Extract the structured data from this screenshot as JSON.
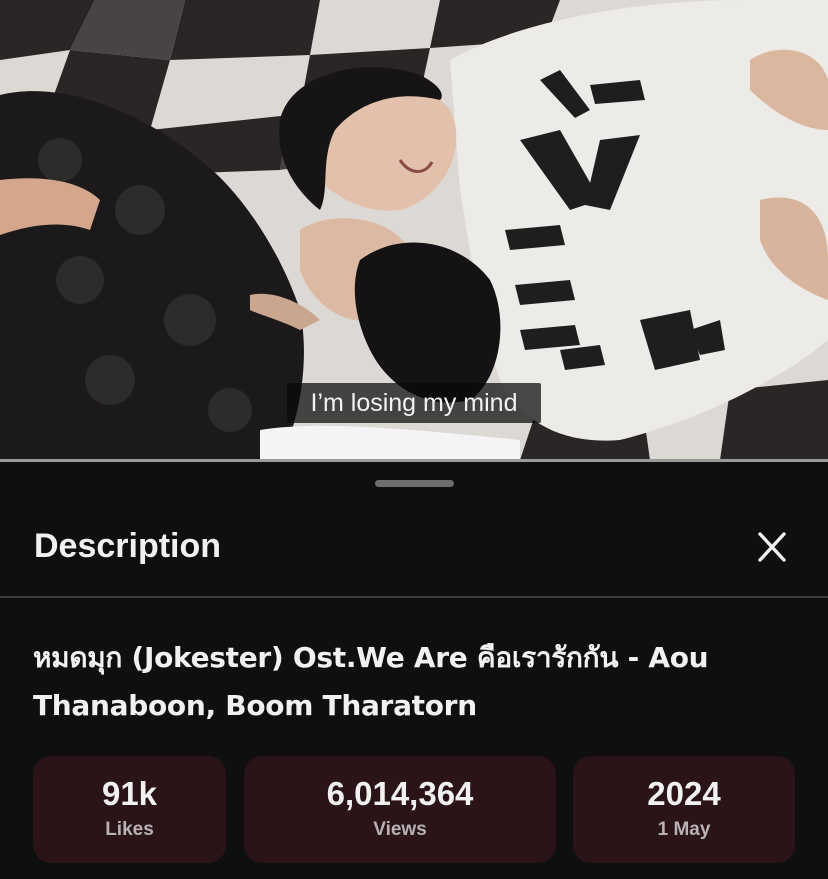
{
  "video": {
    "subtitle": "I’m losing my mind"
  },
  "description_sheet": {
    "heading": "Description",
    "close_icon": "close-icon",
    "video_title": "หมดมุก (Jokester) Ost.We Are คือเรารักกัน - Aou Thanaboon, Boom Tharatorn",
    "stats": [
      {
        "value": "91k",
        "label": "Likes"
      },
      {
        "value": "6,014,364",
        "label": "Views"
      },
      {
        "value": "2024",
        "label": "1 May"
      }
    ]
  },
  "colors": {
    "sheet_background": "#0f0f0f",
    "stat_card_background": "#2a1418",
    "text_primary": "#f1f1f1",
    "text_secondary": "#b8b2b4"
  }
}
